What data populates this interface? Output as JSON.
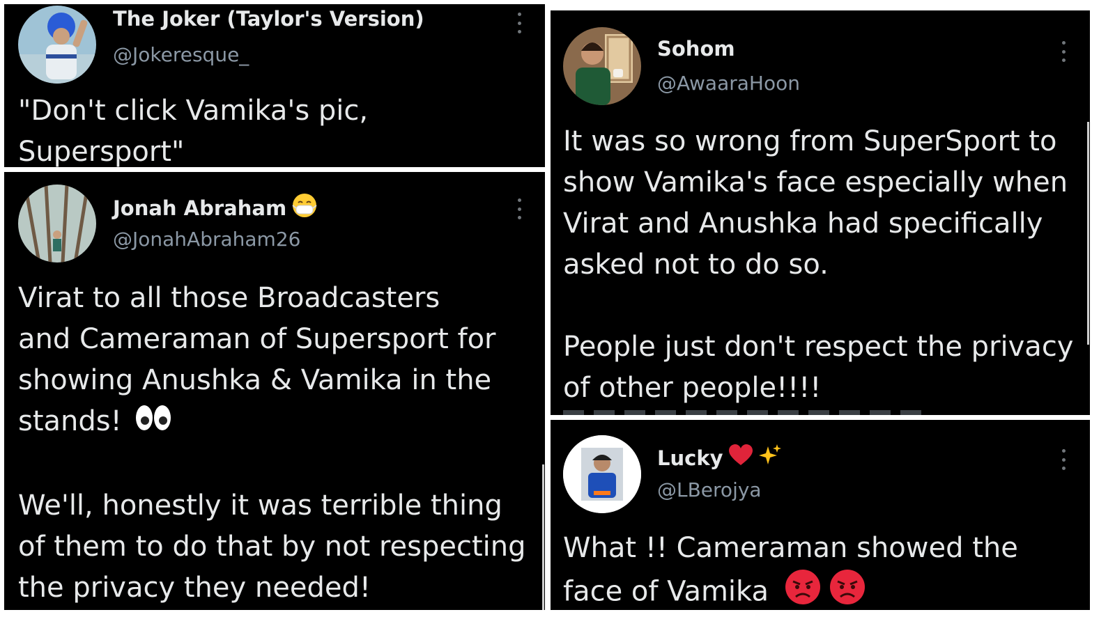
{
  "tweets": [
    {
      "name": "The Joker (Taylor's Version)",
      "handle": "@Jokeresque_",
      "lines": [
        "\"Don't click Vamika's pic,",
        "Supersport\""
      ]
    },
    {
      "name": "Jonah Abraham",
      "handle": "@JonahAbraham26",
      "lines": [
        "Virat to all those Broadcasters",
        "and Cameraman of Supersport for",
        "showing Anushka & Vamika in the",
        "stands!",
        "We'll, honestly it was terrible thing",
        "of them to do that by not respecting",
        "the privacy they needed!"
      ],
      "emojis": [
        "face-with-mask",
        "eyes"
      ]
    },
    {
      "name": "Sohom",
      "handle": "@AwaaraHoon",
      "lines": [
        "It was so wrong from SuperSport to",
        "show Vamika's face especially when",
        "Virat and Anushka had specifically",
        "asked not to do so.",
        "People just don't respect the privacy",
        "of other people!!!!"
      ]
    },
    {
      "name": "Lucky",
      "handle": "@LBerojya",
      "lines": [
        "What !! Cameraman showed the",
        "face of Vamika"
      ],
      "emojis": [
        "red-heart",
        "sparkles",
        "angry-face",
        "angry-face"
      ]
    }
  ],
  "colors": {
    "background": "#000000",
    "text": "#e7e9ea",
    "handle": "#8b98a5",
    "link": "#1d9bf0"
  }
}
